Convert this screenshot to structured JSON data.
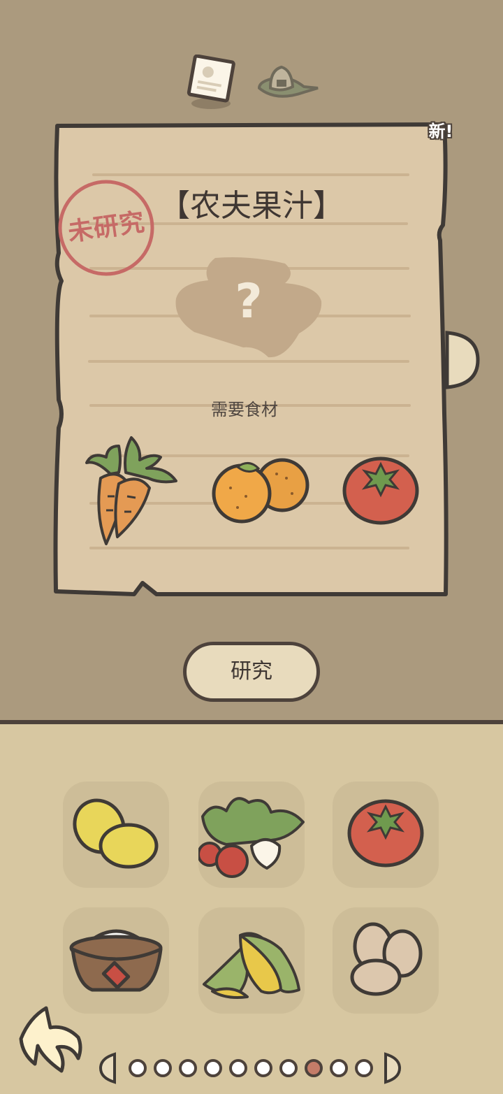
{
  "tabs": [
    {
      "name": "recipe",
      "icon": "recipe-card-icon",
      "active": true
    },
    {
      "name": "food",
      "icon": "rice-ball-icon",
      "active": false
    }
  ],
  "recipe": {
    "new_badge": "新!",
    "stamp": "未研究",
    "title": "【农夫果汁】",
    "unknown_mark": "?",
    "required_label": "需要食材",
    "ingredients": [
      {
        "icon": "carrot-icon"
      },
      {
        "icon": "orange-icon"
      },
      {
        "icon": "tomato-icon"
      }
    ]
  },
  "research_button": "研究",
  "inventory": [
    {
      "icon": "lemon-icon"
    },
    {
      "icon": "radish-icon"
    },
    {
      "icon": "tomato-icon"
    },
    {
      "icon": "flour-bowl-icon"
    },
    {
      "icon": "corn-icon"
    },
    {
      "icon": "eggs-icon"
    }
  ],
  "pagination": {
    "total": 10,
    "current": 8
  },
  "colors": {
    "background": "#ab9a7e",
    "panel": "#d7c7a1",
    "outline": "#4d423b",
    "stamp": "#c66a66",
    "paper": "#dcc8a8"
  }
}
